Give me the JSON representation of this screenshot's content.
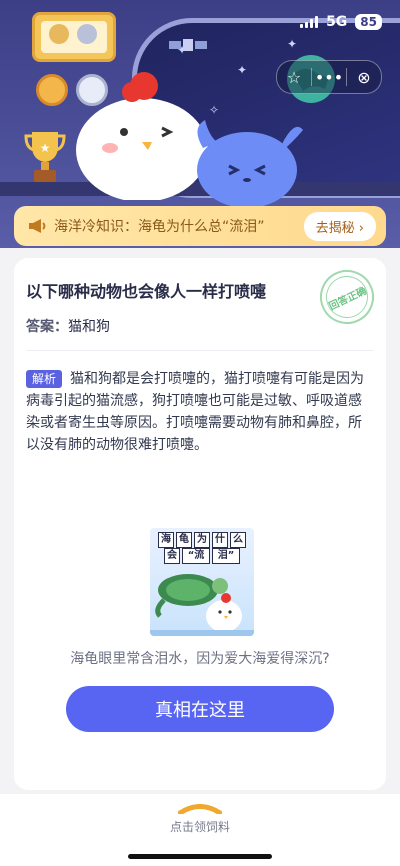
{
  "status_bar": {
    "network": "5G",
    "battery": "85"
  },
  "notice": {
    "text": "海洋冷知识：海龟为什么总“流泪”",
    "button": "去揭秘"
  },
  "question": {
    "title": "以下哪种动物也会像人一样打喷嚏",
    "answer_label": "答案：",
    "answer_value": "猫和狗",
    "stamp_text": "回答正确",
    "explain_tag": "解析",
    "explanation": "猫和狗都是会打喷嚏的，猫打喷嚏有可能是因为病毒引起的猫流感，狗打喷嚏也可能是过敏、呼吸道感染或者寄生虫等原因。打喷嚏需要动物有肺和鼻腔，所以没有肺的动物很难打喷嚏。"
  },
  "illustration": {
    "line1": [
      "海",
      "龟",
      "为",
      "什",
      "么"
    ],
    "line2": [
      "会",
      "“流",
      "泪”"
    ]
  },
  "caption": "海龟眼里常含泪水，因为爱大海爱得深沉?",
  "truth_button": "真相在这里",
  "bottom": {
    "label": "点击领饲料"
  },
  "colors": {
    "accent": "#5865f2",
    "hero": "#3d3f86",
    "notice": "#ffe0a0"
  }
}
